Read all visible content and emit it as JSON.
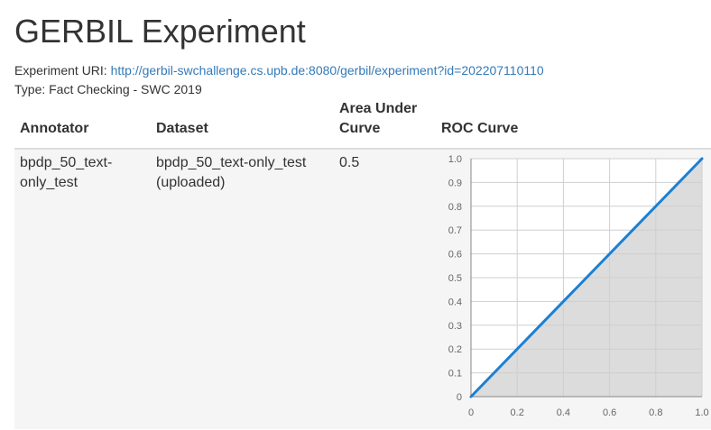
{
  "page": {
    "title": "GERBIL Experiment",
    "uri_label": "Experiment URI:",
    "uri": "http://gerbil-swchallenge.cs.upb.de:8080/gerbil/experiment?id=202207110110",
    "type_text": "Type: Fact Checking - SWC 2019"
  },
  "table": {
    "headers": {
      "annotator": "Annotator",
      "dataset": "Dataset",
      "auc_line1": "Area Under",
      "auc_line2": "Curve",
      "roc": "ROC Curve"
    },
    "rows": [
      {
        "annotator_line1": "bpdp_50_text-",
        "annotator_line2": "only_test",
        "dataset_line1": "bpdp_50_text-only_test",
        "dataset_line2": "(uploaded)",
        "auc": "0.5"
      }
    ]
  },
  "chart_data": {
    "type": "area",
    "x": [
      0,
      1
    ],
    "series": [
      {
        "values": [
          0,
          1
        ]
      }
    ],
    "xticks": [
      "0",
      "0.2",
      "0.4",
      "0.6",
      "0.8",
      "1.0"
    ],
    "yticks": [
      "0",
      "0.1",
      "0.2",
      "0.3",
      "0.4",
      "0.5",
      "0.6",
      "0.7",
      "0.8",
      "0.9",
      "1.0"
    ],
    "xlim": [
      0,
      1
    ],
    "ylim": [
      0,
      1
    ],
    "grid": true,
    "line_color": "#1a80d4",
    "fill_color": "#dcdcdc"
  }
}
